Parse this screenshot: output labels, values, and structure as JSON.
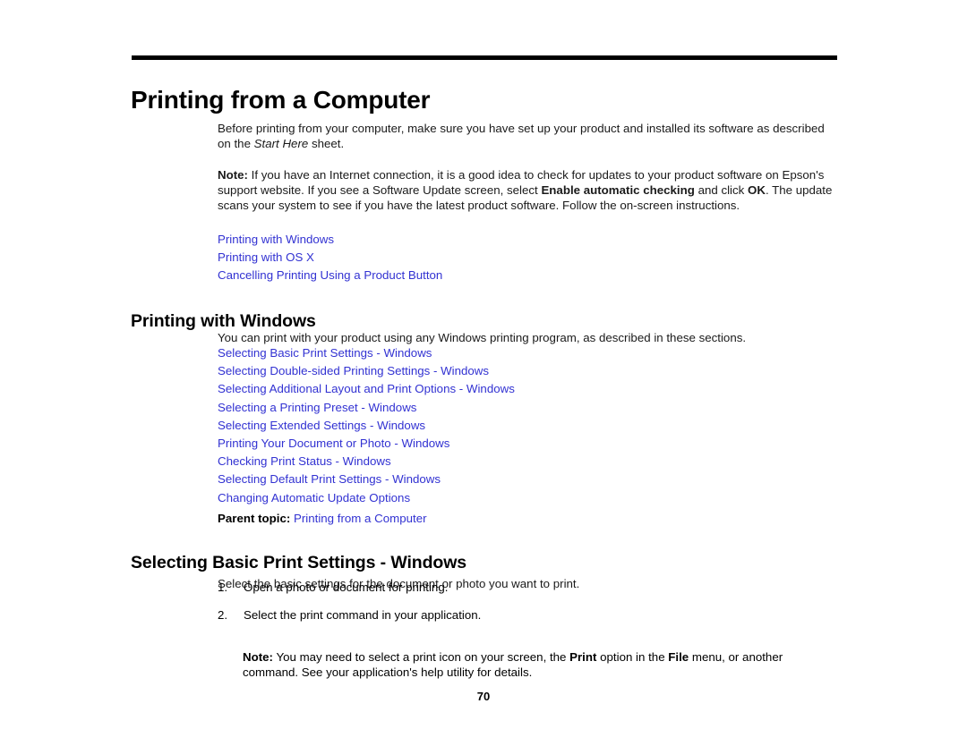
{
  "page": {
    "number": "70"
  },
  "chapter": {
    "title": "Printing from a Computer",
    "intro_before_italic": "Before printing from your computer, make sure you have set up your product and installed its software as described on the ",
    "intro_italic": "Start Here",
    "intro_after_italic": " sheet."
  },
  "note_intro": {
    "label": "Note:",
    "text_1": " If you have an Internet connection, it is a good idea to check for updates to your product software on Epson's support website. If you see a Software Update screen, select ",
    "bold_1": "Enable automatic checking",
    "text_2": " and click ",
    "bold_2": "OK",
    "text_3": ". The update scans your system to see if you have the latest product software. Follow the on-screen instructions."
  },
  "chapter_links": [
    {
      "label": "Printing with Windows"
    },
    {
      "label": "Printing with OS X"
    },
    {
      "label": "Cancelling Printing Using a Product Button"
    }
  ],
  "section_windows": {
    "heading": "Printing with Windows",
    "intro": "You can print with your product using any Windows printing program, as described in these sections.",
    "links": [
      {
        "label": "Selecting Basic Print Settings - Windows"
      },
      {
        "label": "Selecting Double-sided Printing Settings - Windows"
      },
      {
        "label": "Selecting Additional Layout and Print Options - Windows"
      },
      {
        "label": "Selecting a Printing Preset - Windows"
      },
      {
        "label": "Selecting Extended Settings - Windows"
      },
      {
        "label": "Printing Your Document or Photo - Windows"
      },
      {
        "label": "Checking Print Status - Windows"
      },
      {
        "label": "Selecting Default Print Settings - Windows"
      },
      {
        "label": "Changing Automatic Update Options"
      }
    ],
    "parent_topic_label": "Parent topic:",
    "parent_topic_link": "Printing from a Computer"
  },
  "section_basic": {
    "heading": "Selecting Basic Print Settings - Windows",
    "intro": "Select the basic settings for the document or photo you want to print.",
    "steps": [
      {
        "num": "1.",
        "text": "Open a photo or document for printing."
      },
      {
        "num": "2.",
        "text": "Select the print command in your application."
      }
    ],
    "note": {
      "label": "Note:",
      "text_1": " You may need to select a print icon on your screen, the ",
      "bold_1": "Print",
      "text_2": " option in the ",
      "bold_2": "File",
      "text_3": " menu, or another command. See your application's help utility for details."
    }
  },
  "colors": {
    "link": "#3232d2",
    "text": "#000000",
    "background": "#ffffff"
  }
}
